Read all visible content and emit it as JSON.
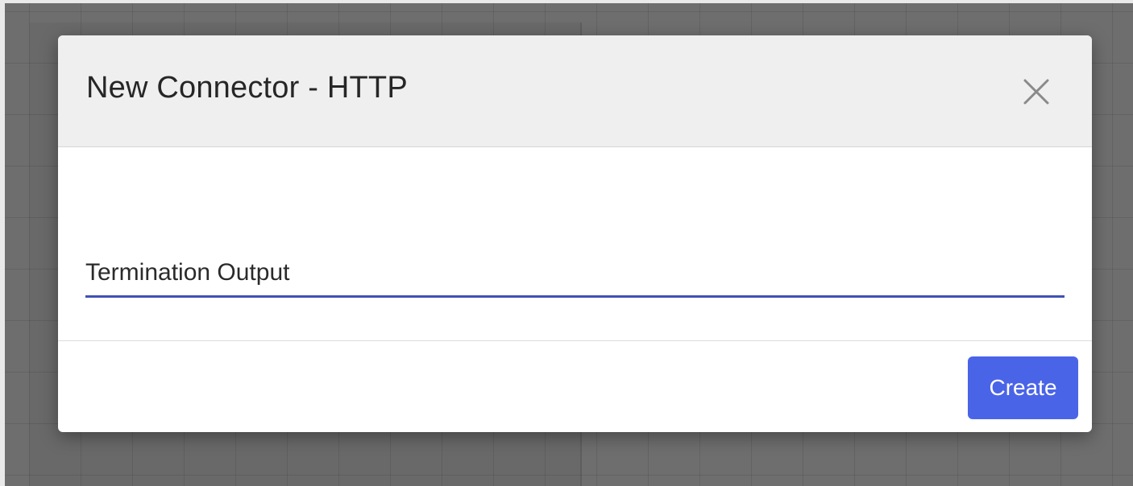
{
  "dialog": {
    "title": "New Connector - HTTP",
    "close_icon": "close-icon",
    "fields": {
      "name": {
        "value": "Termination Output",
        "focused": true,
        "underline_color": "#3f51b5"
      }
    },
    "footer": {
      "create_label": "Create",
      "create_color": "#4a64e8"
    }
  },
  "colors": {
    "overlay": "#6e6e6e",
    "header_bg": "#efefef",
    "title_text": "#262626"
  }
}
